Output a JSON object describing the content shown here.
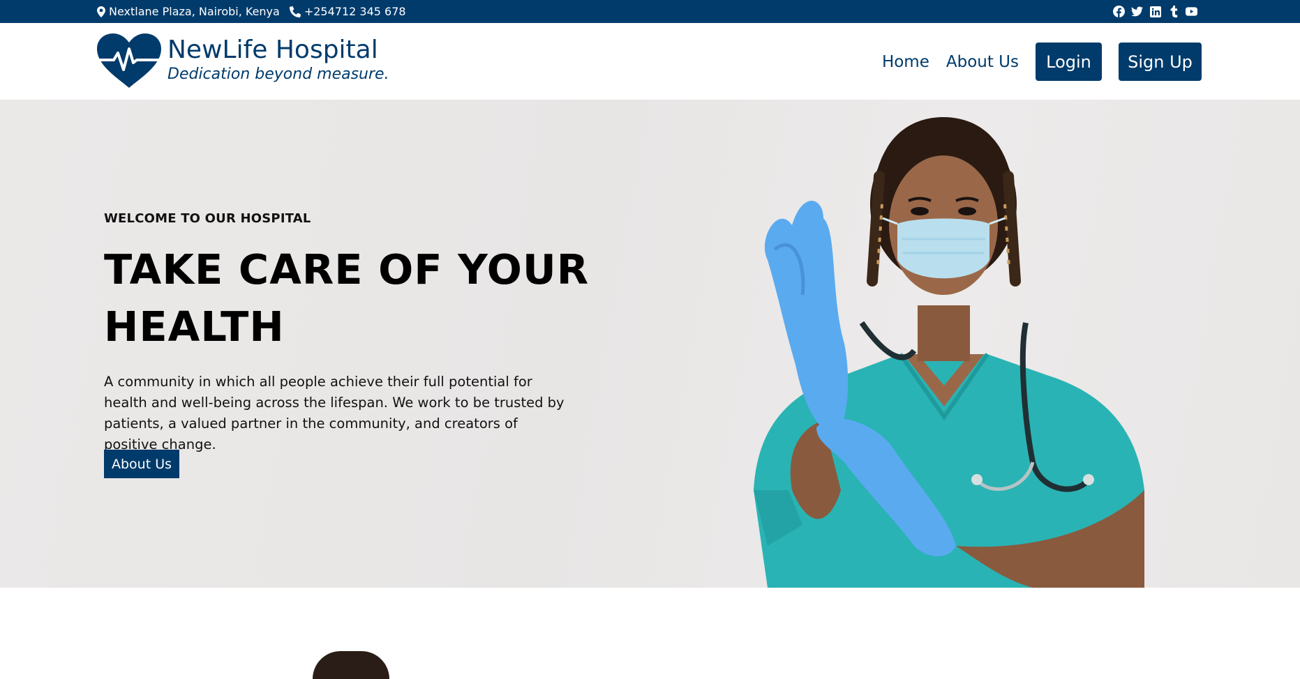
{
  "topbar": {
    "address": "Nextlane Plaza, Nairobi, Kenya",
    "phone": "+254712 345 678",
    "social": [
      "facebook-icon",
      "twitter-icon",
      "linkedin-icon",
      "tumblr-icon",
      "youtube-icon"
    ]
  },
  "header": {
    "brand_name": "NewLife Hospital",
    "tagline": "Dedication beyond measure.",
    "nav": {
      "home": "Home",
      "about": "About Us",
      "login": "Login",
      "signup": "Sign Up"
    }
  },
  "hero": {
    "kicker": "WELCOME TO OUR HOSPITAL",
    "headline": "TAKE CARE OF YOUR HEALTH",
    "description": "A community in which all people achieve their full potential for health and well-being across the lifespan. We work to be trusted by patients, a valued partner in the community, and creators of positive change.",
    "button": "About Us",
    "image": "nurse-with-gloves-photo"
  },
  "colors": {
    "primary": "#003b6b",
    "hero_bg": "#e9e7e6",
    "scrubs": "#2ab3b4",
    "gloves": "#5aaaf0"
  }
}
